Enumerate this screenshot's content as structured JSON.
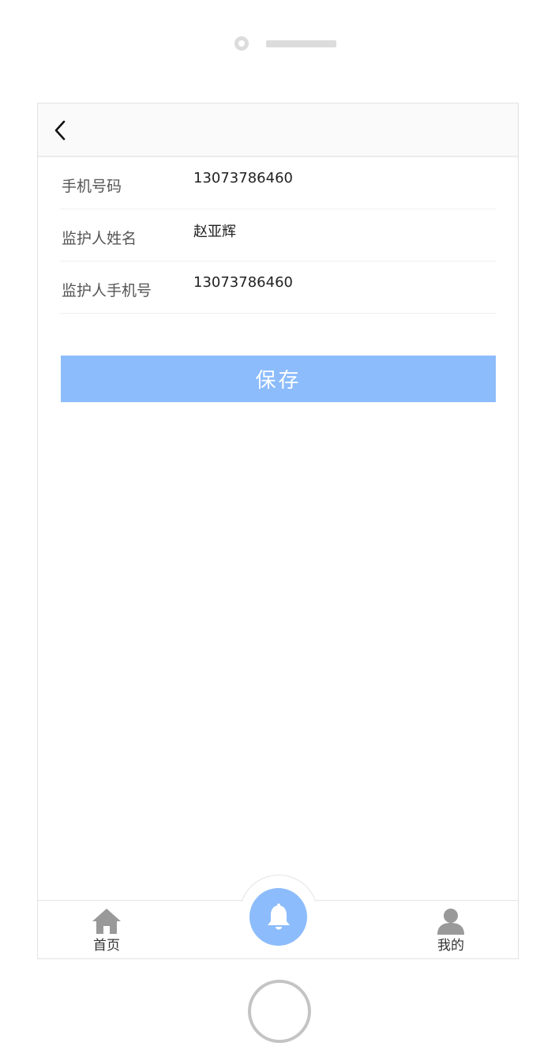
{
  "form": {
    "rows": [
      {
        "label": "手机号码",
        "value": "13073786460"
      },
      {
        "label": "监护人姓名",
        "value": "赵亚辉"
      },
      {
        "label": "监护人手机号",
        "value": "13073786460"
      }
    ]
  },
  "save_label": "保存",
  "tabs": {
    "home": {
      "label": "首页",
      "icon": "home-icon"
    },
    "center": {
      "icon": "bell-icon"
    },
    "mine": {
      "label": "我的",
      "icon": "user-icon"
    }
  },
  "colors": {
    "accent": "#8cbcfc",
    "icon_gray": "#999999"
  }
}
